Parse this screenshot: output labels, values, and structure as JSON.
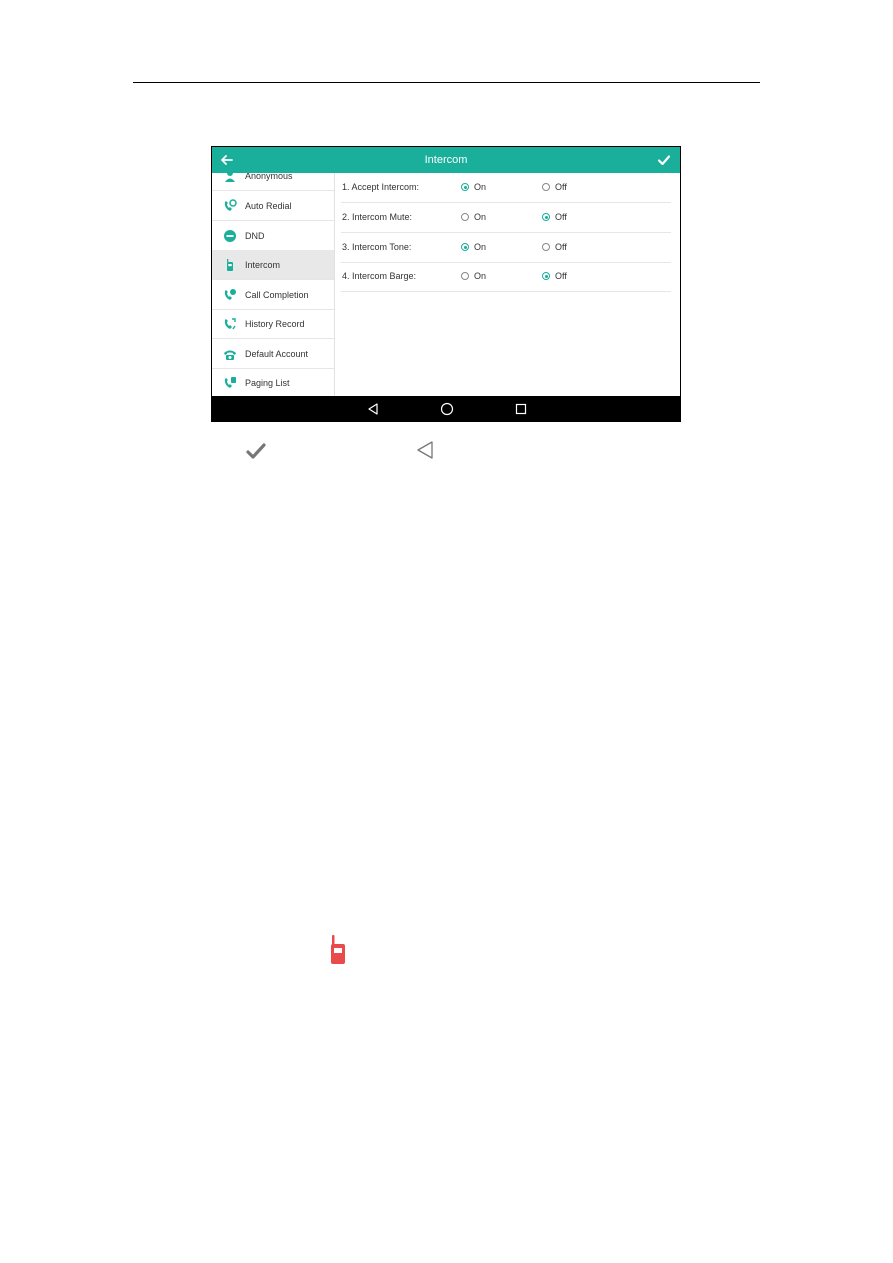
{
  "screen": {
    "title": "Intercom",
    "back_icon": "arrow-left-icon",
    "confirm_icon": "checkmark-icon",
    "accent_color": "#1aaf9a"
  },
  "sidebar": {
    "items": [
      {
        "label": "Anonymous",
        "icon": "anonymous-person-icon",
        "active": false
      },
      {
        "label": "Auto Redial",
        "icon": "auto-redial-icon",
        "active": false
      },
      {
        "label": "DND",
        "icon": "dnd-icon",
        "active": false
      },
      {
        "label": "Intercom",
        "icon": "intercom-icon",
        "active": true
      },
      {
        "label": "Call Completion",
        "icon": "call-completion-icon",
        "active": false
      },
      {
        "label": "History Record",
        "icon": "history-record-icon",
        "active": false
      },
      {
        "label": "Default Account",
        "icon": "default-account-icon",
        "active": false
      },
      {
        "label": "Paging List",
        "icon": "paging-list-icon",
        "active": false
      }
    ]
  },
  "settings": [
    {
      "label": "1. Accept Intercom:",
      "on_label": "On",
      "off_label": "Off",
      "value": "On"
    },
    {
      "label": "2. Intercom Mute:",
      "on_label": "On",
      "off_label": "Off",
      "value": "Off"
    },
    {
      "label": "3. Intercom Tone:",
      "on_label": "On",
      "off_label": "Off",
      "value": "On"
    },
    {
      "label": "4. Intercom Barge:",
      "on_label": "On",
      "off_label": "Off",
      "value": "Off"
    }
  ],
  "navbar": {
    "buttons": [
      "back-triangle-icon",
      "home-circle-icon",
      "recents-square-icon"
    ]
  },
  "document_icons": [
    "checkmark-icon",
    "back-triangle-icon",
    "intercom-red-icon"
  ]
}
